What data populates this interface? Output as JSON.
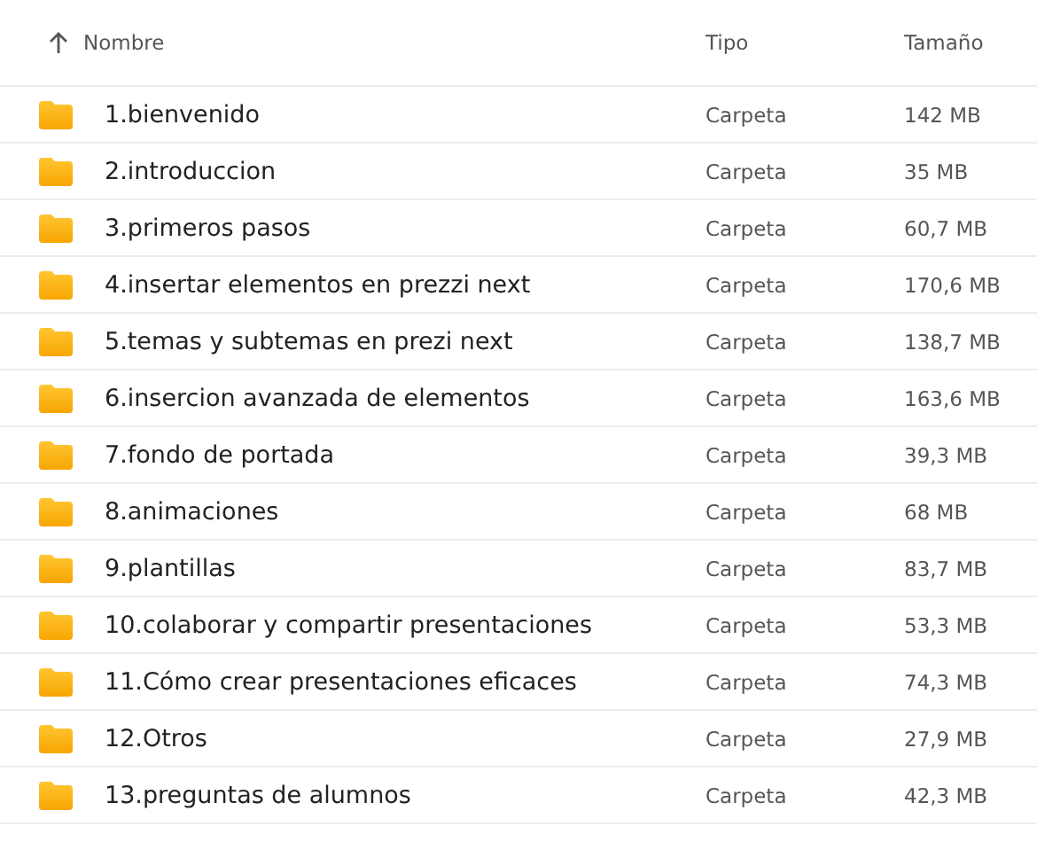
{
  "columns": [
    {
      "label": "Nombre",
      "sorted": true
    },
    {
      "label": "Tipo",
      "sorted": false
    },
    {
      "label": "Tamaño",
      "sorted": false
    }
  ],
  "rows": [
    {
      "name": "1.bienvenido",
      "type": "Carpeta",
      "size": "142 MB"
    },
    {
      "name": "2.introduccion",
      "type": "Carpeta",
      "size": "35 MB"
    },
    {
      "name": "3.primeros pasos",
      "type": "Carpeta",
      "size": "60,7 MB"
    },
    {
      "name": "4.insertar elementos en prezzi next",
      "type": "Carpeta",
      "size": "170,6 MB"
    },
    {
      "name": "5.temas y subtemas en prezi next",
      "type": "Carpeta",
      "size": "138,7 MB"
    },
    {
      "name": "6.insercion avanzada de elementos",
      "type": "Carpeta",
      "size": "163,6 MB"
    },
    {
      "name": "7.fondo de portada",
      "type": "Carpeta",
      "size": "39,3 MB"
    },
    {
      "name": "8.animaciones",
      "type": "Carpeta",
      "size": "68 MB"
    },
    {
      "name": "9.plantillas",
      "type": "Carpeta",
      "size": "83,7 MB"
    },
    {
      "name": "10.colaborar y compartir presentaciones",
      "type": "Carpeta",
      "size": "53,3 MB"
    },
    {
      "name": "11.Cómo crear presentaciones eficaces",
      "type": "Carpeta",
      "size": "74,3 MB"
    },
    {
      "name": "12.Otros",
      "type": "Carpeta",
      "size": "27,9 MB"
    },
    {
      "name": "13.preguntas de alumnos",
      "type": "Carpeta",
      "size": "42,3 MB"
    }
  ]
}
